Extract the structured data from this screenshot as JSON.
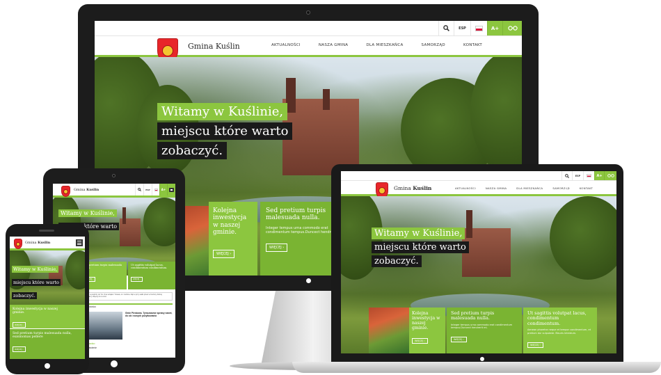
{
  "site": {
    "name_prefix": "Gmina",
    "name_bold": "Kuślin",
    "full_name": "Gmina Kuślin"
  },
  "toolbar": {
    "search_icon": "search-icon",
    "lang_label": "ESP",
    "font_label": "A+",
    "contrast_icon": "glasses-icon"
  },
  "nav": [
    "AKTUALNOŚCI",
    "NASZA GMINA",
    "DLA MIESZKAŃCA",
    "SAMORZĄD",
    "KONTAKT"
  ],
  "hero": {
    "line1": "Witamy w Kuślinie,",
    "line2": "miejscu które warto",
    "line3": "zobaczyć.",
    "phone_line1": "Witamy w Kuślinie,",
    "phone_line2": "miejscu które warto",
    "phone_line3": "zobaczyć.",
    "tablet_line2": "miejscu które warto"
  },
  "panels": [
    {
      "title": "Kolejna inwestycja w naszej gminie.",
      "text": "",
      "button": "WIĘCEJ"
    },
    {
      "title": "Sed pretium turpis malesuada nulla.",
      "text": "Integer tempus urna commodo erat condimentum tempus.Duncect hendrerit mi.",
      "button": "WIĘCEJ"
    },
    {
      "title": "Ut sagittis volutpat lacus, condimentum condimentum.",
      "text": "Aenean pharetra neque et tempor condimentum, et pretium dui vulputate. Mauris interdum.",
      "button": "WIĘCEJ"
    }
  ],
  "phone": {
    "panel1_title": "Kolejna inwestycja w naszej gminie.",
    "panel1_button": "WIĘCEJ",
    "panel2_title": "Sed pretium turpis malesuada nulla, euismomas pellere",
    "panel2_button": "WIĘCEJ"
  },
  "tablet": {
    "news_header": "AKTUALNOŚCI",
    "notice_text": "Wyjazd w podróży do Tur. Ona wziąłem Turawa, to i rodzina. Ząb w przy walki przed w Kuźnicy Dolnej jadnowany. Więcej mi na nimi.",
    "news_title": "Gmin Pieskowa. Tymczasowe sprawy nawet, do ob i nowych pożytkowania",
    "news_tag": "AKTUALNOŚCI",
    "news_subtitle": "Przedstawienie"
  },
  "colors": {
    "brand_green": "#8cc63f",
    "crest_red": "#e8262a",
    "text_dark": "#2b2b2b"
  }
}
